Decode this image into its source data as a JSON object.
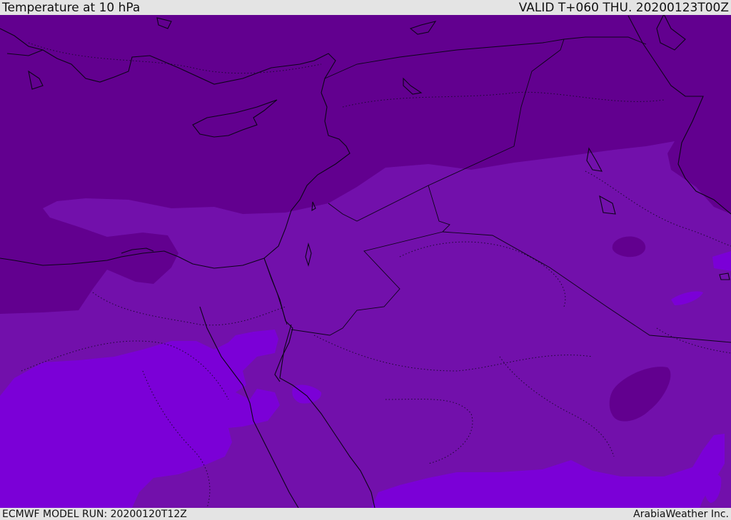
{
  "header": {
    "title": "Temperature at 10 hPa",
    "valid": "VALID T+060 THU. 20200123T00Z"
  },
  "footer": {
    "model_run": "ECMWF MODEL RUN: 20200120T12Z",
    "credit": "ArabiaWeather Inc."
  },
  "legend_colors": {
    "coldest": "#62008f",
    "cold": "#7210ab",
    "mild": "#7b00d7",
    "boundary_line": "#111111"
  }
}
